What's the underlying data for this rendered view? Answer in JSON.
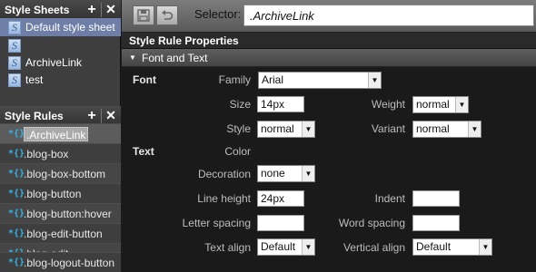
{
  "style_sheets": {
    "title": "Style Sheets",
    "add_icon": "+",
    "close_icon": "✕",
    "items": [
      {
        "label": "Default style sheet"
      },
      {
        "label": ""
      },
      {
        "label": "ArchiveLink"
      },
      {
        "label": "test"
      }
    ],
    "icon_letter": "S"
  },
  "style_rules": {
    "title": "Style Rules",
    "add_icon": "+",
    "close_icon": "✕",
    "rule_icon": "*{}",
    "items": [
      {
        "label": ".ArchiveLink"
      },
      {
        "label": ".blog-box"
      },
      {
        "label": ".blog-box-bottom"
      },
      {
        "label": ".blog-button"
      },
      {
        "label": ".blog-button:hover"
      },
      {
        "label": ".blog-edit-button"
      },
      {
        "label": ".blog-edit"
      },
      {
        "label": ".blog-logout-button"
      }
    ]
  },
  "toolbar": {
    "selector_label": "Selector:",
    "selector_value": ".ArchiveLink"
  },
  "properties": {
    "title": "Style Rule Properties",
    "section": "Font and Text",
    "groups": {
      "font": "Font",
      "text": "Text"
    },
    "family": {
      "label": "Family",
      "value": "Arial"
    },
    "size": {
      "label": "Size",
      "value": "14px"
    },
    "weight": {
      "label": "Weight",
      "value": "normal"
    },
    "style": {
      "label": "Style",
      "value": "normal"
    },
    "variant": {
      "label": "Variant",
      "value": "normal"
    },
    "color": {
      "label": "Color"
    },
    "decoration": {
      "label": "Decoration",
      "value": "none"
    },
    "line_height": {
      "label": "Line height",
      "value": "24px"
    },
    "indent": {
      "label": "Indent",
      "value": ""
    },
    "letter_spacing": {
      "label": "Letter spacing",
      "value": ""
    },
    "word_spacing": {
      "label": "Word spacing",
      "value": ""
    },
    "text_align": {
      "label": "Text align",
      "value": "Default"
    },
    "vertical_align": {
      "label": "Vertical align",
      "value": "Default"
    }
  },
  "colors": {
    "selected_sheet": "#6e7ea6",
    "rule_icon": "#35b4e8"
  }
}
